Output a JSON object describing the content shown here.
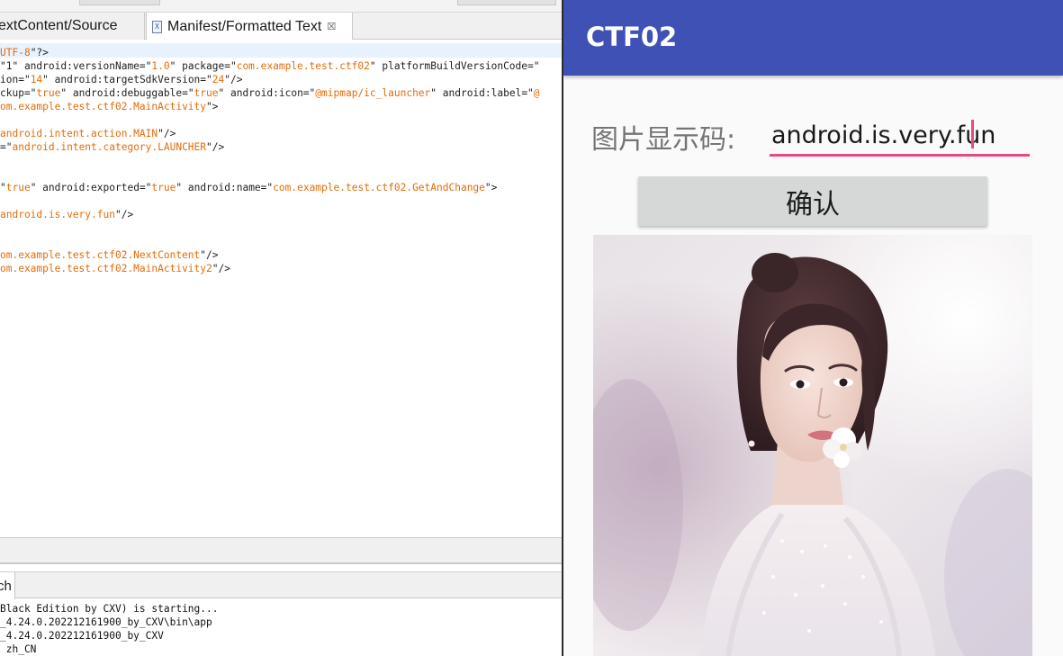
{
  "ide": {
    "tabs": [
      {
        "label": "extContent/Source"
      },
      {
        "label": "Manifest/Formatted Text"
      }
    ],
    "code_lines": [
      [
        {
          "t": "UTF-8",
          "c": "s"
        },
        {
          "t": "\"?>",
          "c": "p"
        }
      ],
      [
        {
          "t": "\"1\" android:versionName=\"",
          "c": "p"
        },
        {
          "t": "1.0",
          "c": "s"
        },
        {
          "t": "\" package=\"",
          "c": "p"
        },
        {
          "t": "com.example.test.ctf02",
          "c": "s"
        },
        {
          "t": "\" platformBuildVersionCode=\"",
          "c": "p"
        }
      ],
      [
        {
          "t": "ion=\"",
          "c": "p"
        },
        {
          "t": "14",
          "c": "s"
        },
        {
          "t": "\" android:targetSdkVersion=\"",
          "c": "p"
        },
        {
          "t": "24",
          "c": "s"
        },
        {
          "t": "\"/>",
          "c": "p"
        }
      ],
      [
        {
          "t": "ckup=\"",
          "c": "p"
        },
        {
          "t": "true",
          "c": "s"
        },
        {
          "t": "\" android:debuggable=\"",
          "c": "p"
        },
        {
          "t": "true",
          "c": "s"
        },
        {
          "t": "\" android:icon=\"",
          "c": "p"
        },
        {
          "t": "@mipmap/ic_launcher",
          "c": "s"
        },
        {
          "t": "\" android:label=\"",
          "c": "p"
        },
        {
          "t": "@",
          "c": "s"
        }
      ],
      [
        {
          "t": "om.example.test.ctf02.MainActivity",
          "c": "s"
        },
        {
          "t": "\">",
          "c": "p"
        }
      ],
      [
        {
          "t": "android.intent.action.MAIN",
          "c": "s"
        },
        {
          "t": "\"/>",
          "c": "p"
        }
      ],
      [
        {
          "t": "=\"",
          "c": "p"
        },
        {
          "t": "android.intent.category.LAUNCHER",
          "c": "s"
        },
        {
          "t": "\"/>",
          "c": "p"
        }
      ],
      [
        {
          "t": "\"",
          "c": "p"
        },
        {
          "t": "true",
          "c": "s"
        },
        {
          "t": "\" android:exported=\"",
          "c": "p"
        },
        {
          "t": "true",
          "c": "s"
        },
        {
          "t": "\" android:name=\"",
          "c": "p"
        },
        {
          "t": "com.example.test.ctf02.GetAndChange",
          "c": "s"
        },
        {
          "t": "\">",
          "c": "p"
        }
      ],
      [
        {
          "t": "android.is.very.fun",
          "c": "s"
        },
        {
          "t": "\"/>",
          "c": "p"
        }
      ],
      [
        {
          "t": "om.example.test.ctf02.NextContent",
          "c": "s"
        },
        {
          "t": "\"/>",
          "c": "p"
        }
      ],
      [
        {
          "t": "om.example.test.ctf02.MainActivity2",
          "c": "s"
        },
        {
          "t": "\"/>",
          "c": "p"
        }
      ]
    ],
    "console_tab_label": "ch",
    "console_lines": [
      "Black Edition by CXV) is starting...",
      "_4.24.0.202212161900_by_CXV\\bin\\app",
      "_4.24.0.202212161900_by_CXV",
      " zh_CN"
    ]
  },
  "app": {
    "title": "CTF02",
    "label": "图片显示码:",
    "input_value": "android.is.very.fun",
    "button_label": "确认",
    "colors": {
      "app_bar": "#3f51b5",
      "accent": "#e94a7f",
      "button": "#d6d7d7"
    }
  }
}
